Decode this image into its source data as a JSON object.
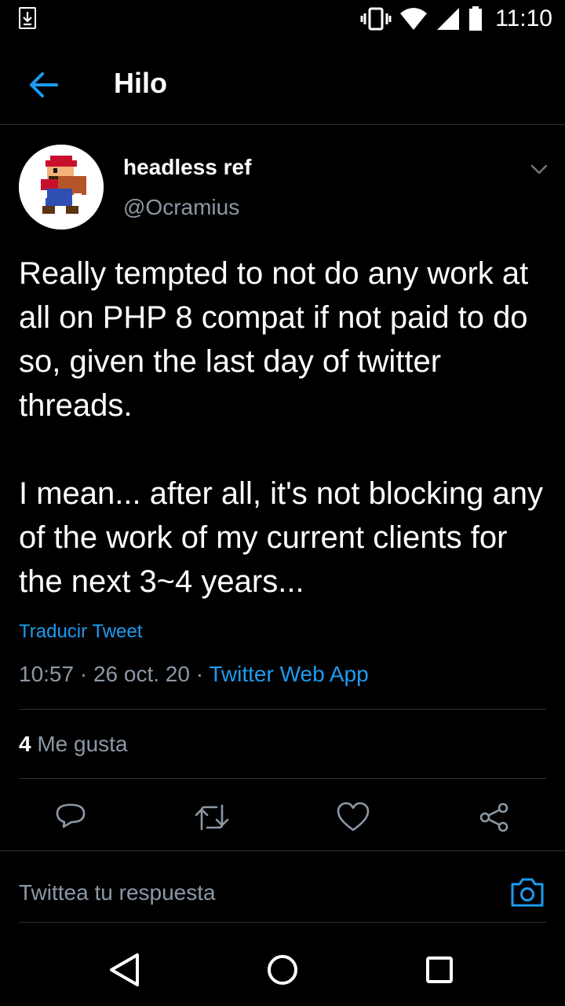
{
  "status_bar": {
    "time": "11:10",
    "icons": [
      "download-icon",
      "vibrate-icon",
      "wifi-icon",
      "signal-icon",
      "battery-icon"
    ]
  },
  "header": {
    "back_icon": "arrow-left-icon",
    "title": "Hilo"
  },
  "tweet": {
    "author_name": "headless ref",
    "author_handle": "@Ocramius",
    "text": "Really tempted to not do any work at all on PHP 8 compat if not paid to do so, given the last day of twitter threads.\n\nI mean... after all, it's not blocking any of the work of my current clients for the next 3~4 years...",
    "translate_label": "Traducir Tweet",
    "time": "10:57",
    "date": "26 oct. 20",
    "separator": " · ",
    "source": "Twitter Web App",
    "like_count": "4",
    "like_label": "Me gusta"
  },
  "actions": {
    "icons": [
      "reply-icon",
      "retweet-icon",
      "like-icon",
      "share-icon"
    ]
  },
  "reply_bar": {
    "placeholder": "Twittea tu respuesta",
    "camera_icon": "camera-icon"
  },
  "nav_bar": {
    "icons": [
      "back-triangle-icon",
      "home-circle-icon",
      "recents-square-icon"
    ]
  },
  "colors": {
    "background": "#000000",
    "accent": "#1d9bf0",
    "secondary_text": "#8b98a5",
    "divider": "#2f3336"
  }
}
